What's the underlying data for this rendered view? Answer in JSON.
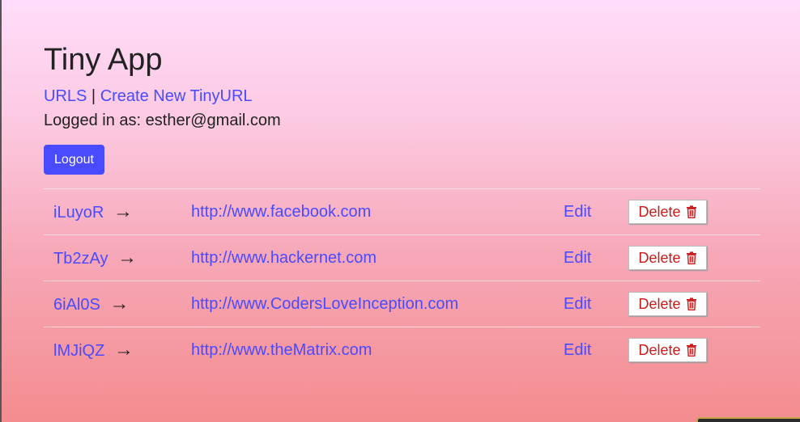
{
  "app": {
    "title": "Tiny App"
  },
  "nav": {
    "urls_label": "URLS",
    "separator": "|",
    "create_label": "Create New TinyURL"
  },
  "user": {
    "logged_in_text": "Logged in as: esther@gmail.com"
  },
  "logout_label": "Logout",
  "urls": [
    {
      "short": "iLuyoR",
      "long": "http://www.facebook.com",
      "edit_label": "Edit",
      "delete_label": "Delete"
    },
    {
      "short": "Tb2zAy",
      "long": "http://www.hackernet.com",
      "edit_label": "Edit",
      "delete_label": "Delete"
    },
    {
      "short": "6iAl0S",
      "long": "http://www.CodersLoveInception.com",
      "edit_label": "Edit",
      "delete_label": "Delete"
    },
    {
      "short": "lMJiQZ",
      "long": "http://www.theMatrix.com",
      "edit_label": "Edit",
      "delete_label": "Delete"
    }
  ],
  "arrow_glyph": "→",
  "colors": {
    "link": "#4a4aff",
    "logout_bg": "#4a4aff",
    "delete_text": "#cc1a1a"
  },
  "icons": {
    "arrow": "right-arrow-icon",
    "delete": "trash-icon"
  }
}
